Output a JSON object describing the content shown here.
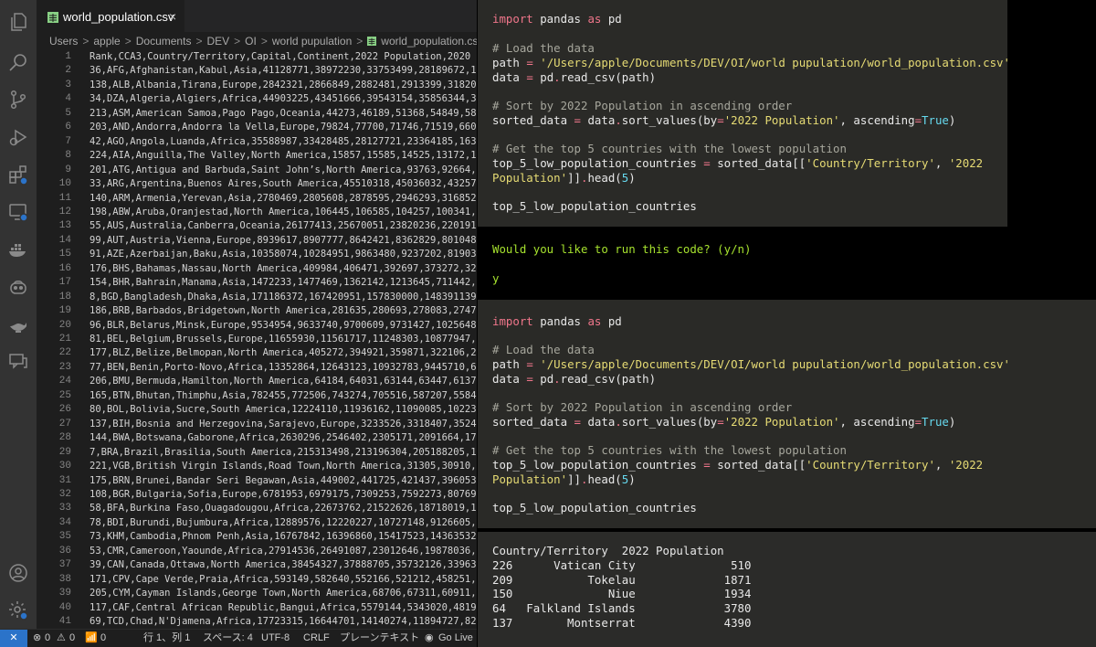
{
  "editor": {
    "tab_title": "world_population.csv",
    "tab_close_glyph": "×",
    "breadcrumb": [
      "Users",
      "apple",
      "Documents",
      "DEV",
      "OI",
      "world pupulation",
      "world_population.csv"
    ],
    "breadcrumb_separator": ">",
    "line_numbers": [
      "1",
      "2",
      "3",
      "4",
      "5",
      "6",
      "7",
      "8",
      "9",
      "10",
      "11",
      "12",
      "13",
      "14",
      "15",
      "16",
      "17",
      "18",
      "19",
      "20",
      "21",
      "22",
      "23",
      "24",
      "25",
      "26",
      "27",
      "28",
      "29",
      "30",
      "31",
      "32",
      "33",
      "34",
      "35",
      "36",
      "37",
      "38",
      "39",
      "40",
      "41"
    ],
    "lines": [
      "Rank,CCA3,Country/Territory,Capital,Continent,2022 Population,2020 P",
      "36,AFG,Afghanistan,Kabul,Asia,41128771,38972230,33753499,28189672,1",
      "138,ALB,Albania,Tirana,Europe,2842321,2866849,2882481,2913399,318202",
      "34,DZA,Algeria,Algiers,Africa,44903225,43451666,39543154,35856344,3",
      "213,ASM,American Samoa,Pago Pago,Oceania,44273,46189,51368,54849,58",
      "203,AND,Andorra,Andorra la Vella,Europe,79824,77700,71746,71519,6605",
      "42,AGO,Angola,Luanda,Africa,35588987,33428485,28127721,23364185,163",
      "224,AIA,Anguilla,The Valley,North America,15857,15585,14525,13172,1",
      "201,ATG,Antigua and Barbuda,Saint John’s,North America,93763,92664,",
      "33,ARG,Argentina,Buenos Aires,South America,45510318,45036032,43257",
      "140,ARM,Armenia,Yerevan,Asia,2780469,2805608,2878595,2946293,316852",
      "198,ABW,Aruba,Oranjestad,North America,106445,106585,104257,100341,",
      "55,AUS,Australia,Canberra,Oceania,26177413,25670051,23820236,220191",
      "99,AUT,Austria,Vienna,Europe,8939617,8907777,8642421,8362829,801048",
      "91,AZE,Azerbaijan,Baku,Asia,10358074,10284951,9863480,9237202,81903",
      "176,BHS,Bahamas,Nassau,North America,409984,406471,392697,373272,32",
      "154,BHR,Bahrain,Manama,Asia,1472233,1477469,1362142,1213645,711442,",
      "8,BGD,Bangladesh,Dhaka,Asia,171186372,167420951,157830000,148391139,",
      "186,BRB,Barbados,Bridgetown,North America,281635,280693,278083,2747",
      "96,BLR,Belarus,Minsk,Europe,9534954,9633740,9700609,9731427,1025648",
      "81,BEL,Belgium,Brussels,Europe,11655930,11561717,11248303,10877947,",
      "177,BLZ,Belize,Belmopan,North America,405272,394921,359871,322106,2",
      "77,BEN,Benin,Porto-Novo,Africa,13352864,12643123,10932783,9445710,6",
      "206,BMU,Bermuda,Hamilton,North America,64184,64031,63144,63447,6137",
      "165,BTN,Bhutan,Thimphu,Asia,782455,772506,743274,705516,587207,5584",
      "80,BOL,Bolivia,Sucre,South America,12224110,11936162,11090085,10223",
      "137,BIH,Bosnia and Herzegovina,Sarajevo,Europe,3233526,3318407,3524",
      "144,BWA,Botswana,Gaborone,Africa,2630296,2546402,2305171,2091664,17",
      "7,BRA,Brazil,Brasilia,South America,215313498,213196304,205188205,1",
      "221,VGB,British Virgin Islands,Road Town,North America,31305,30910,",
      "175,BRN,Brunei,Bandar Seri Begawan,Asia,449002,441725,421437,396053",
      "108,BGR,Bulgaria,Sofia,Europe,6781953,6979175,7309253,7592273,80769",
      "58,BFA,Burkina Faso,Ouagadougou,Africa,22673762,21522626,18718019,1",
      "78,BDI,Burundi,Bujumbura,Africa,12889576,12220227,10727148,9126605,",
      "73,KHM,Cambodia,Phnom Penh,Asia,16767842,16396860,15417523,14363532",
      "53,CMR,Cameroon,Yaounde,Africa,27914536,26491087,23012646,19878036,",
      "39,CAN,Canada,Ottawa,North America,38454327,37888705,35732126,339634",
      "171,CPV,Cape Verde,Praia,Africa,593149,582640,552166,521212,458251,",
      "205,CYM,Cayman Islands,George Town,North America,68706,67311,60911,",
      "117,CAF,Central African Republic,Bangui,Africa,5579144,5343020,48193",
      "69,TCD,Chad,N'Djamena,Africa,17723315,16644701,14140274,11894727,82"
    ]
  },
  "statusbar": {
    "errors": "0",
    "warnings": "0",
    "ports": "0",
    "position": "行 1、列 1",
    "spaces": "スペース: 4",
    "encoding": "UTF-8",
    "eol": "CRLF",
    "language": "プレーンテキスト",
    "golive": "Go Live"
  },
  "terminal": {
    "code_block": {
      "import_kw": "import",
      "import_mod": " pandas ",
      "as_kw": "as",
      "import_alias": " pd",
      "comment_load": "# Load the data",
      "path_var": "path ",
      "eq": "=",
      "path_str": "'/Users/apple/Documents/DEV/OI/world pupulation/world_population.csv'",
      "data_var": "data ",
      "data_call_pre": " pd",
      "dot": ".",
      "data_call_post": "read_csv(path)",
      "comment_sort": "# Sort by 2022 Population in ascending order",
      "sorted_var": "sorted_data ",
      "sorted_call_pre": " data",
      "sorted_call_mid": "sort_values(by",
      "sorted_by": "'2022 Population'",
      "sorted_asc": ", ascending",
      "true_kw": "True",
      "close": ")",
      "comment_top": "# Get the top 5 countries with the lowest population",
      "top_var": "top_5_low_population_countries ",
      "top_call_pre": " sorted_data[[",
      "top_col1": "'Country/Territory'",
      "top_comma": ", ",
      "top_col2a": "'2022",
      "top_col2b": "Population'",
      "top_close": "]]",
      "head_call": "head(",
      "head_n": "5",
      "final_expr": "top_5_low_population_countries"
    },
    "prompt": "Would you like to run this code? (y/n)",
    "answer": "y",
    "output": {
      "header": "Country/Territory  2022 Population",
      "rows": [
        "226      Vatican City              510",
        "209           Tokelau             1871",
        "150              Niue             1934",
        "64   Falkland Islands             3780",
        "137        Montserrat             4390"
      ]
    }
  },
  "chart_data": {
    "type": "table",
    "columns": [
      "",
      "Country/Territory",
      "2022 Population"
    ],
    "rows": [
      [
        "226",
        "Vatican City",
        510
      ],
      [
        "209",
        "Tokelau",
        1871
      ],
      [
        "150",
        "Niue",
        1934
      ],
      [
        "64",
        "Falkland Islands",
        3780
      ],
      [
        "137",
        "Montserrat",
        4390
      ]
    ]
  }
}
